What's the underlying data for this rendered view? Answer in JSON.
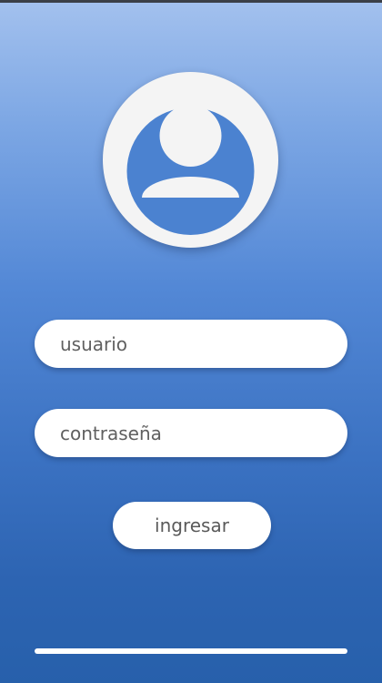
{
  "colors": {
    "gradient_top": "#a3c1ee",
    "gradient_bottom": "#2760ab",
    "field_background": "#ffffff",
    "avatar_background": "#f4f4f4",
    "avatar_icon": "#4b82d0"
  },
  "avatar": {
    "icon": "user-icon"
  },
  "login_form": {
    "username": {
      "placeholder": "usuario",
      "value": ""
    },
    "password": {
      "placeholder": "contraseña",
      "value": ""
    },
    "submit_label": "ingresar"
  }
}
